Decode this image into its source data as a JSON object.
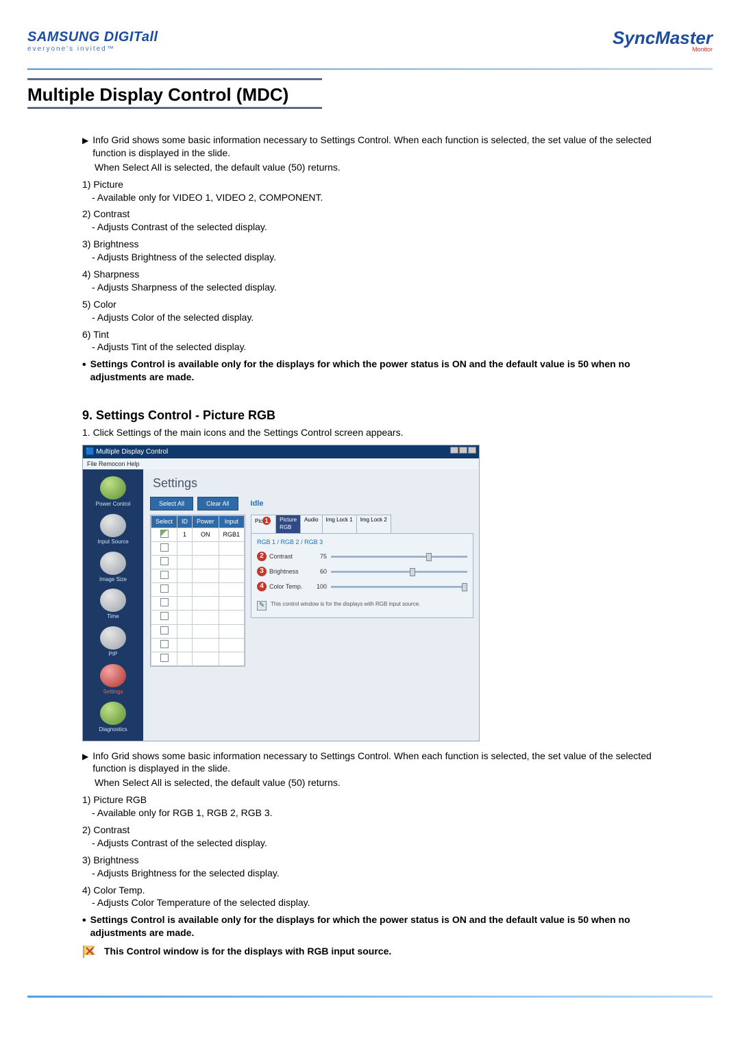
{
  "header": {
    "brand_left_line1": "SAMSUNG DIGITall",
    "brand_left_line2": "everyone's invited™",
    "brand_right_main": "SyncMaster",
    "brand_right_sub": "Monitor"
  },
  "title": "Multiple Display Control (MDC)",
  "intro": {
    "bullet": "Info Grid shows some basic information necessary to Settings Control. When each function is selected, the set value of the selected function is displayed in the slide.",
    "line2": "When Select All is selected, the default value (50) returns."
  },
  "list1": [
    {
      "n": "1)",
      "label": "Picture",
      "desc": "- Available only for VIDEO 1, VIDEO 2, COMPONENT."
    },
    {
      "n": "2)",
      "label": "Contrast",
      "desc": "- Adjusts Contrast of the selected display."
    },
    {
      "n": "3)",
      "label": "Brightness",
      "desc": "- Adjusts Brightness of the selected display."
    },
    {
      "n": "4)",
      "label": "Sharpness",
      "desc": "- Adjusts Sharpness of the selected display."
    },
    {
      "n": "5)",
      "label": "Color",
      "desc": "- Adjusts Color of the selected display."
    },
    {
      "n": "6)",
      "label": "Tint",
      "desc": "- Adjusts Tint of the selected display."
    }
  ],
  "bold_note1": "Settings Control is available only for the displays for which the power status is ON and the default value is 50 when no adjustments are made.",
  "section9": {
    "heading": "9. Settings Control - Picture RGB",
    "intro": "1.  Click Settings of the main icons and the Settings Control screen appears."
  },
  "mdc": {
    "title": "Multiple Display Control",
    "menu": "File   Remocon   Help",
    "sidebar": [
      {
        "label": "Power Control",
        "cls": "si-green"
      },
      {
        "label": "Input Source",
        "cls": "si-gray"
      },
      {
        "label": "Image Size",
        "cls": "si-gray"
      },
      {
        "label": "Time",
        "cls": "si-gray"
      },
      {
        "label": "PIP",
        "cls": "si-gray"
      },
      {
        "label": "Settings",
        "cls": "si-red",
        "red": true
      },
      {
        "label": "Diagnostics",
        "cls": "si-green"
      }
    ],
    "panel_heading": "Settings",
    "btn_select_all": "Select All",
    "btn_clear_all": "Clear All",
    "idle": "Idle",
    "grid": {
      "headers": [
        "Select",
        "ID",
        "Power",
        "Input"
      ],
      "rows": [
        {
          "on": true,
          "id": "1",
          "power": "ON",
          "input": "RGB1"
        },
        {
          "on": false
        },
        {
          "on": false
        },
        {
          "on": false
        },
        {
          "on": false
        },
        {
          "on": false
        },
        {
          "on": false
        },
        {
          "on": false
        },
        {
          "on": false
        },
        {
          "on": false
        }
      ]
    },
    "tabs": {
      "t0": "Pic",
      "t1_callout": "1",
      "t1a": "Picture",
      "t1b": "RGB",
      "t2": "Audio",
      "t3": "Img Lock 1",
      "t4": "Img Lock 2"
    },
    "sub": "RGB 1 / RGB 2 / RGB 3",
    "sliders": [
      {
        "n": "2",
        "label": "Contrast",
        "val": "75",
        "pos": 70
      },
      {
        "n": "3",
        "label": "Brightness",
        "val": "60",
        "pos": 58
      },
      {
        "n": "4",
        "label": "Color Temp.",
        "val": "100",
        "pos": 96
      }
    ],
    "panel_note": "This control window is for the displays with RGB input source."
  },
  "intro2": {
    "bullet": "Info Grid shows some basic information necessary to Settings Control. When each function is selected, the set value of the selected function is displayed in the slide.",
    "line2": "When Select All is selected, the default value (50) returns."
  },
  "list2": [
    {
      "n": "1)",
      "label": "Picture RGB",
      "desc": "- Available only for RGB 1, RGB 2, RGB 3."
    },
    {
      "n": "2)",
      "label": "Contrast",
      "desc": "- Adjusts Contrast of the selected display."
    },
    {
      "n": "3)",
      "label": "Brightness",
      "desc": "- Adjusts Brightness for the selected display."
    },
    {
      "n": "4)",
      "label": "Color Temp.",
      "desc": "- Adjusts Color Temperature of the selected display."
    }
  ],
  "bold_note2": "Settings Control is available only for the displays for which the power status is ON and the default value is 50 when no adjustments are made.",
  "footer_note": "This Control window is for the displays with RGB input source."
}
